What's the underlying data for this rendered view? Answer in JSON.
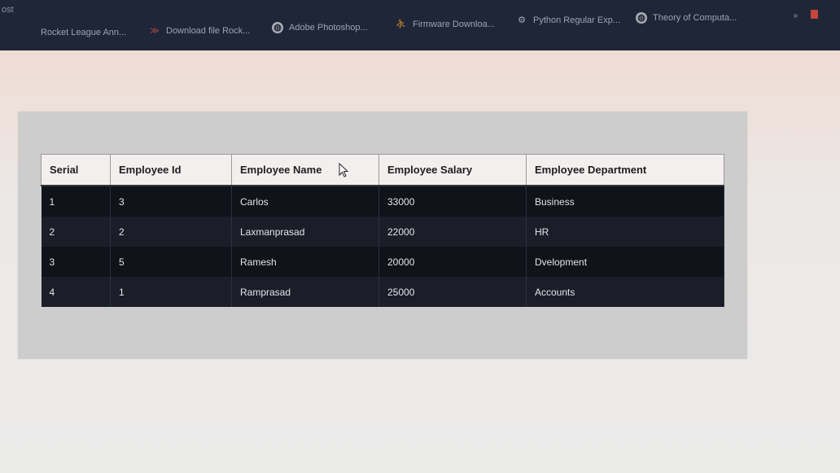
{
  "bookmarks_bar": {
    "corner_text": "ost",
    "items": [
      {
        "label": "Rocket League Ann...",
        "icon": "none"
      },
      {
        "label": "Download file Rock...",
        "icon": "chevrons-icon"
      },
      {
        "label": "Adobe Photoshop...",
        "icon": "globe-icon"
      },
      {
        "label": "Firmware Downloa...",
        "icon": "person-icon"
      },
      {
        "label": "Python Regular Exp...",
        "icon": "gear-icon"
      },
      {
        "label": "Theory of Computa...",
        "icon": "globe-icon"
      }
    ],
    "overflow": "»"
  },
  "table": {
    "headers": {
      "serial": "Serial",
      "employee_id": "Employee Id",
      "employee_name": "Employee Name",
      "employee_salary": "Employee Salary",
      "employee_department": "Employee Department"
    },
    "rows": [
      {
        "serial": "1",
        "id": "3",
        "name": "Carlos",
        "salary": "33000",
        "department": "Business"
      },
      {
        "serial": "2",
        "id": "2",
        "name": "Laxmanprasad",
        "salary": "22000",
        "department": "HR"
      },
      {
        "serial": "3",
        "id": "5",
        "name": "Ramesh",
        "salary": "20000",
        "department": "Dvelopment"
      },
      {
        "serial": "4",
        "id": "1",
        "name": "Ramprasad",
        "salary": "25000",
        "department": "Accounts"
      }
    ]
  },
  "colors": {
    "bookmarks_bg": "#1f2638",
    "header_bg": "#f3efee",
    "row_dark": "#10131a",
    "row_alt": "#1b1e28",
    "panel_bg": "#cdcdcd"
  }
}
